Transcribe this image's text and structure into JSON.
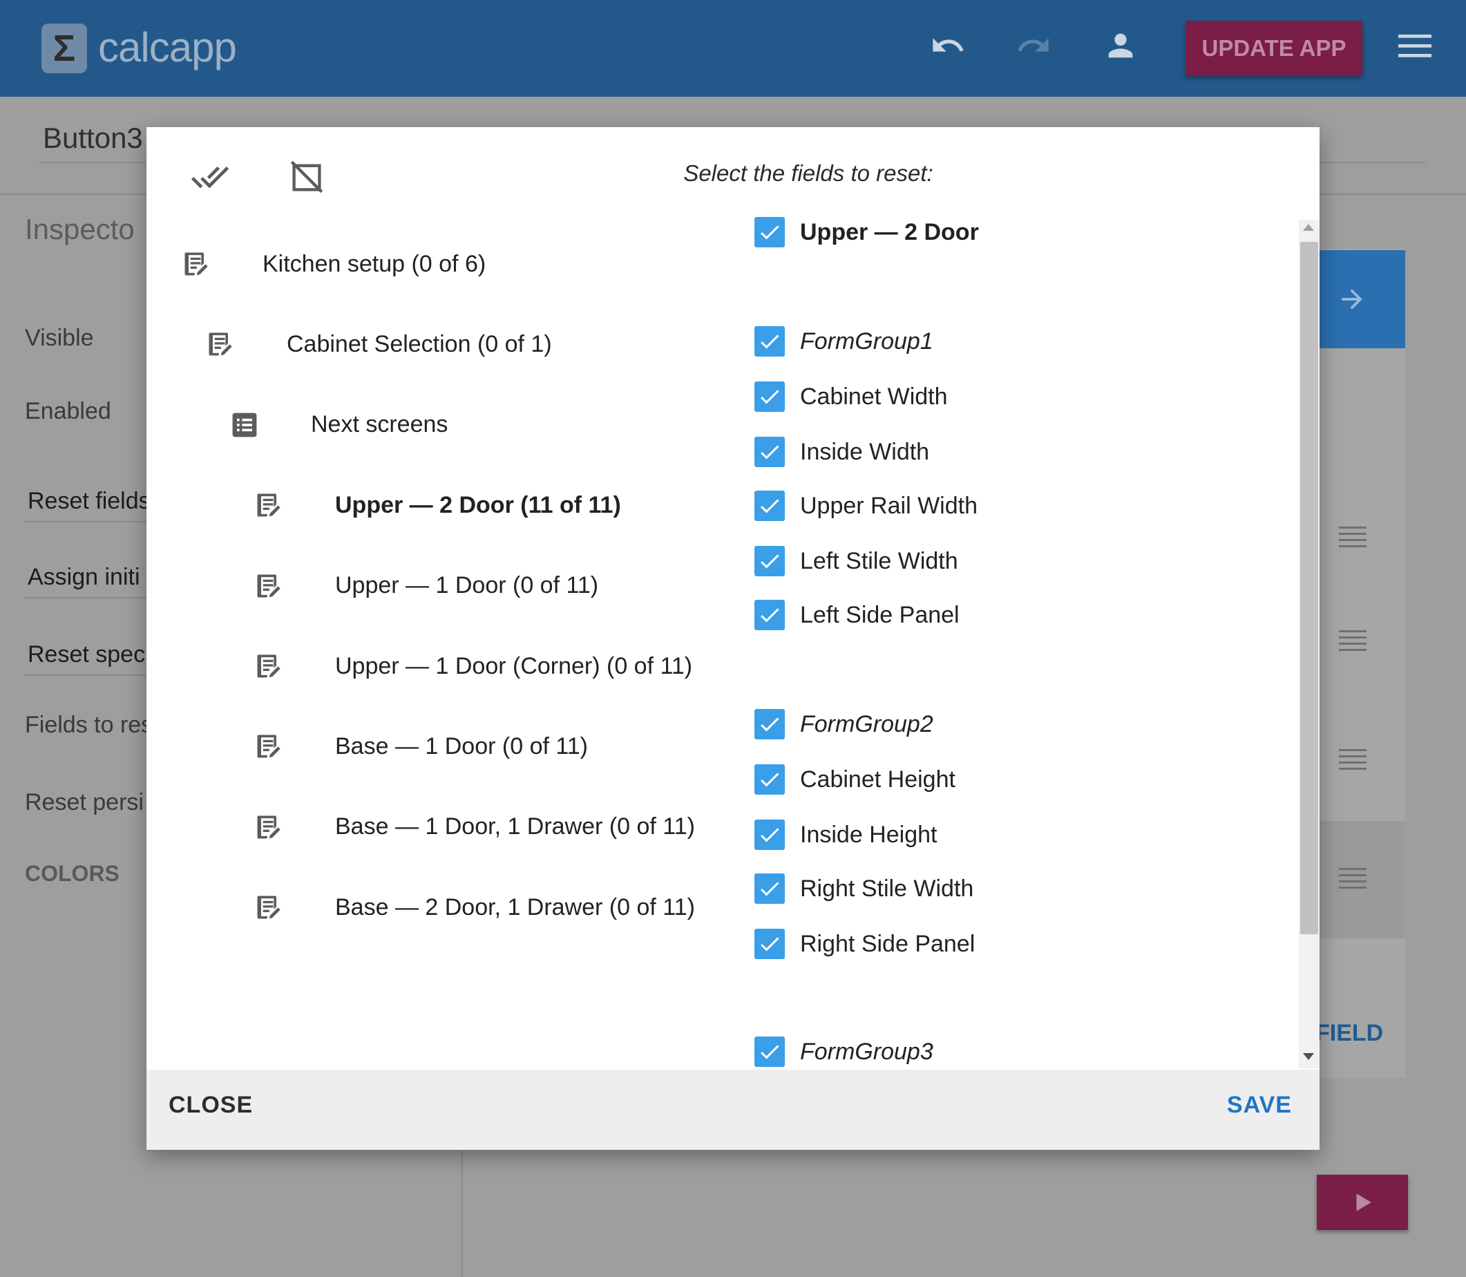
{
  "app": {
    "logo_symbol": "Σ",
    "name": "calcapp",
    "update_button": "UPDATE APP",
    "brand_color": "#23588a",
    "accent_color": "#7a1d47"
  },
  "background": {
    "title": "Button3",
    "inspector": "Inspecto",
    "labels": {
      "visible": "Visible",
      "enabled": "Enabled",
      "reset_fields": "Reset fields",
      "assign_initial": "Assign initi",
      "reset_specific": "Reset spec",
      "fields_to_reset": "Fields to res",
      "reset_persisted": "Reset persi",
      "colors": "COLORS"
    },
    "field_link": "FIELD"
  },
  "dialog": {
    "heading": "Select the fields to reset:",
    "tree": [
      {
        "label": "Kitchen setup (0 of 6)",
        "icon": "form-icon",
        "level": 0,
        "bold": false
      },
      {
        "label": "Cabinet Selection (0 of 1)",
        "icon": "form-icon",
        "level": 1,
        "bold": false
      },
      {
        "label": "Next screens",
        "icon": "list-icon",
        "level": 2,
        "bold": false
      },
      {
        "label": "Upper — 2 Door (11 of 11)",
        "icon": "form-icon",
        "level": 3,
        "bold": true
      },
      {
        "label": "Upper — 1 Door (0 of 11)",
        "icon": "form-icon",
        "level": 3,
        "bold": false
      },
      {
        "label": "Upper — 1 Door (Corner) (0 of 11)",
        "icon": "form-icon",
        "level": 3,
        "bold": false
      },
      {
        "label": "Base — 1 Door (0 of 11)",
        "icon": "form-icon",
        "level": 3,
        "bold": false
      },
      {
        "label": "Base — 1 Door, 1 Drawer (0 of 11)",
        "icon": "form-icon",
        "level": 3,
        "bold": false
      },
      {
        "label": "Base — 2 Door, 1 Drawer (0 of 11)",
        "icon": "form-icon",
        "level": 3,
        "bold": false
      }
    ],
    "fields": [
      {
        "label": "Upper — 2 Door",
        "checked": true,
        "style": "bold"
      },
      {
        "label": "FormGroup1",
        "checked": true,
        "style": "italic"
      },
      {
        "label": "Cabinet Width",
        "checked": true,
        "style": "normal"
      },
      {
        "label": "Inside Width",
        "checked": true,
        "style": "normal"
      },
      {
        "label": "Upper Rail Width",
        "checked": true,
        "style": "normal"
      },
      {
        "label": "Left Stile Width",
        "checked": true,
        "style": "normal"
      },
      {
        "label": "Left Side Panel",
        "checked": true,
        "style": "normal"
      },
      {
        "label": "FormGroup2",
        "checked": true,
        "style": "italic"
      },
      {
        "label": "Cabinet Height",
        "checked": true,
        "style": "normal"
      },
      {
        "label": "Inside Height",
        "checked": true,
        "style": "normal"
      },
      {
        "label": "Right Stile Width",
        "checked": true,
        "style": "normal"
      },
      {
        "label": "Right Side Panel",
        "checked": true,
        "style": "normal"
      },
      {
        "label": "FormGroup3",
        "checked": true,
        "style": "italic"
      }
    ],
    "close_button": "CLOSE",
    "save_button": "SAVE",
    "checkbox_color": "#3a9ee8",
    "save_color": "#1f74c4"
  }
}
